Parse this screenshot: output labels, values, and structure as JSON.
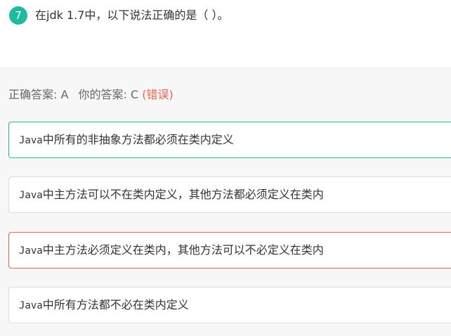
{
  "question": {
    "number": "7",
    "text": "在jdk 1.7中，以下说法正确的是（    ）。"
  },
  "answer": {
    "correct_label": "正确答案: A",
    "yours_label": "你的答案: C",
    "status": "(错误)"
  },
  "options": [
    {
      "code": "Java",
      "text": "中所有的非抽象方法都必须在类内定义",
      "state": "correct"
    },
    {
      "code": "Java",
      "text": "中主方法可以不在类内定义，其他方法都必须定义在类内",
      "state": "neutral"
    },
    {
      "code": "Java",
      "text": "中主方法必须定义在类内，其他方法可以不必定义在类内",
      "state": "incorrect"
    },
    {
      "code": "Java",
      "text": "中所有方法都不必在类内定义",
      "state": "neutral"
    }
  ],
  "colors": {
    "accent": "#1fb99d",
    "error": "#e8644f"
  }
}
